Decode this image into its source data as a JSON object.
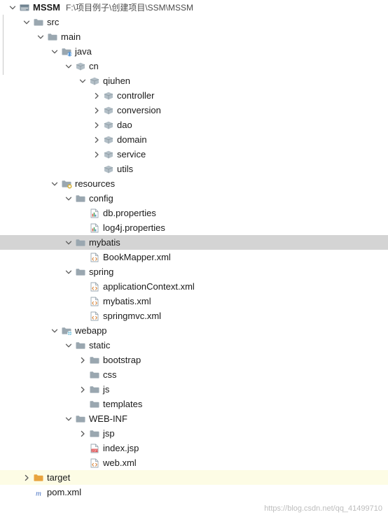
{
  "window": {
    "watermark": "https://blog.csdn.net/qq_41499710"
  },
  "tree": {
    "root_path": "F:\\项目例子\\创建项目\\SSM\\MSSM",
    "nodes": [
      {
        "label": "MSSM",
        "depth": 0,
        "arrow": "down",
        "icon": "module-icon",
        "state": "none",
        "bold": true,
        "path": true
      },
      {
        "label": "src",
        "depth": 1,
        "arrow": "down",
        "icon": "folder-blue",
        "state": "none",
        "bold": false,
        "path": false
      },
      {
        "label": "main",
        "depth": 2,
        "arrow": "down",
        "icon": "folder-blue",
        "state": "none",
        "bold": false,
        "path": false
      },
      {
        "label": "java",
        "depth": 3,
        "arrow": "down",
        "icon": "folder-source",
        "state": "none",
        "bold": false,
        "path": false
      },
      {
        "label": "cn",
        "depth": 4,
        "arrow": "down",
        "icon": "package-icon",
        "state": "none",
        "bold": false,
        "path": false
      },
      {
        "label": "qiuhen",
        "depth": 5,
        "arrow": "down",
        "icon": "package-icon",
        "state": "none",
        "bold": false,
        "path": false
      },
      {
        "label": "controller",
        "depth": 6,
        "arrow": "right",
        "icon": "package-icon",
        "state": "none",
        "bold": false,
        "path": false
      },
      {
        "label": "conversion",
        "depth": 6,
        "arrow": "right",
        "icon": "package-icon",
        "state": "none",
        "bold": false,
        "path": false
      },
      {
        "label": "dao",
        "depth": 6,
        "arrow": "right",
        "icon": "package-icon",
        "state": "none",
        "bold": false,
        "path": false
      },
      {
        "label": "domain",
        "depth": 6,
        "arrow": "right",
        "icon": "package-icon",
        "state": "none",
        "bold": false,
        "path": false
      },
      {
        "label": "service",
        "depth": 6,
        "arrow": "right",
        "icon": "package-icon",
        "state": "none",
        "bold": false,
        "path": false
      },
      {
        "label": "utils",
        "depth": 6,
        "arrow": "none",
        "icon": "package-icon",
        "state": "none",
        "bold": false,
        "path": false
      },
      {
        "label": "resources",
        "depth": 3,
        "arrow": "down",
        "icon": "folder-resource",
        "state": "none",
        "bold": false,
        "path": false
      },
      {
        "label": "config",
        "depth": 4,
        "arrow": "down",
        "icon": "folder-plain",
        "state": "none",
        "bold": false,
        "path": false
      },
      {
        "label": "db.properties",
        "depth": 5,
        "arrow": "none",
        "icon": "properties-icon",
        "state": "none",
        "bold": false,
        "path": false
      },
      {
        "label": "log4j.properties",
        "depth": 5,
        "arrow": "none",
        "icon": "properties-icon",
        "state": "none",
        "bold": false,
        "path": false
      },
      {
        "label": "mybatis",
        "depth": 4,
        "arrow": "down",
        "icon": "folder-plain",
        "state": "selected",
        "bold": false,
        "path": false
      },
      {
        "label": "BookMapper.xml",
        "depth": 5,
        "arrow": "none",
        "icon": "xml-icon",
        "state": "none",
        "bold": false,
        "path": false
      },
      {
        "label": "spring",
        "depth": 4,
        "arrow": "down",
        "icon": "folder-plain",
        "state": "none",
        "bold": false,
        "path": false
      },
      {
        "label": "applicationContext.xml",
        "depth": 5,
        "arrow": "none",
        "icon": "xml-icon",
        "state": "none",
        "bold": false,
        "path": false
      },
      {
        "label": "mybatis.xml",
        "depth": 5,
        "arrow": "none",
        "icon": "xml-icon",
        "state": "none",
        "bold": false,
        "path": false
      },
      {
        "label": "springmvc.xml",
        "depth": 5,
        "arrow": "none",
        "icon": "xml-icon",
        "state": "none",
        "bold": false,
        "path": false
      },
      {
        "label": "webapp",
        "depth": 3,
        "arrow": "down",
        "icon": "folder-web",
        "state": "none",
        "bold": false,
        "path": false
      },
      {
        "label": "static",
        "depth": 4,
        "arrow": "down",
        "icon": "folder-plain",
        "state": "none",
        "bold": false,
        "path": false
      },
      {
        "label": "bootstrap",
        "depth": 5,
        "arrow": "right",
        "icon": "folder-plain",
        "state": "none",
        "bold": false,
        "path": false
      },
      {
        "label": "css",
        "depth": 5,
        "arrow": "none",
        "icon": "folder-plain",
        "state": "none",
        "bold": false,
        "path": false
      },
      {
        "label": "js",
        "depth": 5,
        "arrow": "right",
        "icon": "folder-plain",
        "state": "none",
        "bold": false,
        "path": false
      },
      {
        "label": "templates",
        "depth": 5,
        "arrow": "none",
        "icon": "folder-plain",
        "state": "none",
        "bold": false,
        "path": false
      },
      {
        "label": "WEB-INF",
        "depth": 4,
        "arrow": "down",
        "icon": "folder-plain",
        "state": "none",
        "bold": false,
        "path": false
      },
      {
        "label": "jsp",
        "depth": 5,
        "arrow": "right",
        "icon": "folder-plain",
        "state": "none",
        "bold": false,
        "path": false
      },
      {
        "label": "index.jsp",
        "depth": 5,
        "arrow": "none",
        "icon": "jsp-icon",
        "state": "none",
        "bold": false,
        "path": false
      },
      {
        "label": "web.xml",
        "depth": 5,
        "arrow": "none",
        "icon": "xml-icon",
        "state": "none",
        "bold": false,
        "path": false
      },
      {
        "label": "target",
        "depth": 1,
        "arrow": "right",
        "icon": "folder-orange",
        "state": "highlight",
        "bold": false,
        "path": false
      },
      {
        "label": "pom.xml",
        "depth": 1,
        "arrow": "none",
        "icon": "maven-icon",
        "state": "none",
        "bold": false,
        "path": false
      }
    ]
  },
  "colors": {
    "selection": "#d4d4d4",
    "highlight": "#fdfce5",
    "folder_blue": "#9aa7b0",
    "folder_orange": "#e8a33d",
    "package_gray": "#a3b1bb"
  }
}
